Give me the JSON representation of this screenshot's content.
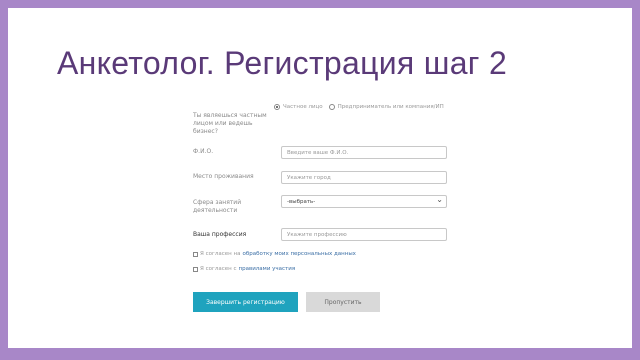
{
  "title": "Анкетолог. Регистрация шаг 2",
  "form": {
    "status_label": "Ты являешься частным\nлицом или ведешь\nбизнес?",
    "radio_options": [
      {
        "label": "Частное лицо",
        "selected": true
      },
      {
        "label": "Предприниматель или компания/ИП",
        "selected": false
      }
    ],
    "name_label": "Ф.И.О.",
    "name_placeholder": "Введите ваше Ф.И.О.",
    "city_label": "Место проживания",
    "city_placeholder": "Укажите город",
    "sphere_label": "Сфера занятий\nдеятельности",
    "sphere_selected": "-выбрать-",
    "profession_label": "Ваша профессия",
    "profession_placeholder": "Укажите профессию",
    "consent1_prefix": "Я согласен на",
    "consent1_link": "обработку моих персональных данных",
    "consent2_prefix": "Я согласен с",
    "consent2_link": "правилами участия"
  },
  "buttons": {
    "finish": "Завершить регистрацию",
    "skip": "Пропустить"
  },
  "colors": {
    "frame": "#a887c8",
    "title": "#5a3a78",
    "primary": "#1fa3be",
    "secondary": "#d9d9d9",
    "link": "#3a6ea5"
  }
}
